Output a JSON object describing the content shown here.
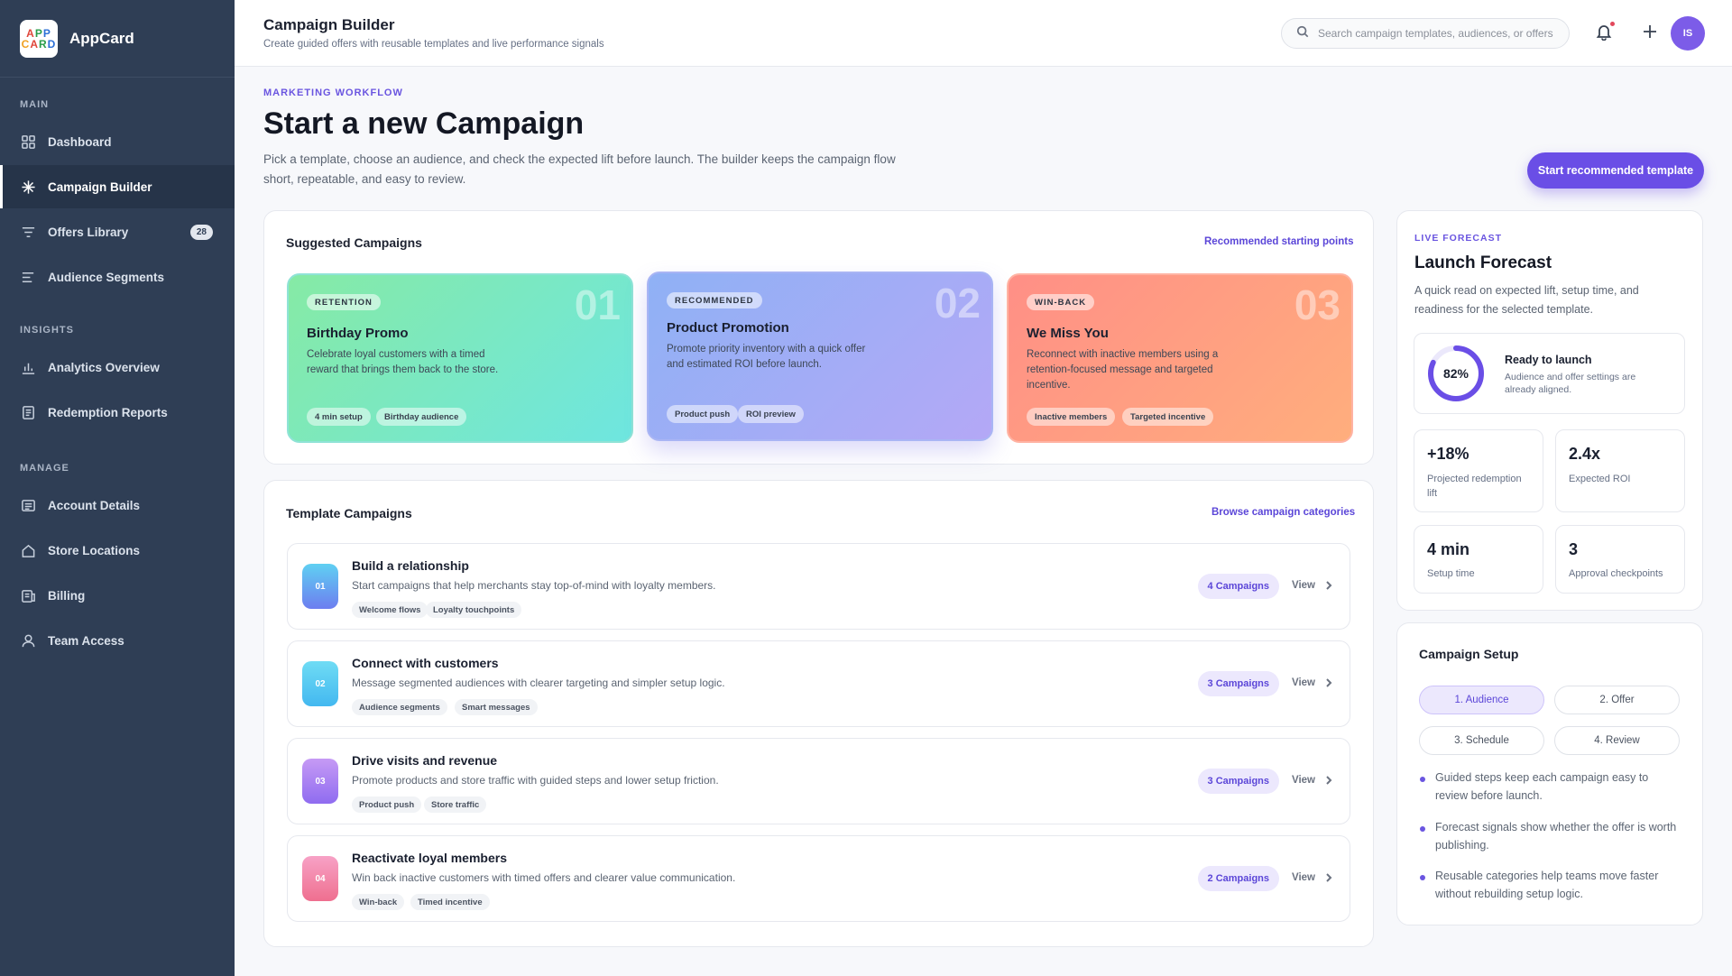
{
  "brand": {
    "logo_line1": [
      "A",
      "P",
      "P"
    ],
    "logo_line2": [
      "C",
      "A",
      "R",
      "D"
    ],
    "name": "AppCard"
  },
  "sidebar": {
    "sections": [
      "MAIN",
      "INSIGHTS",
      "MANAGE"
    ],
    "items": [
      {
        "label": "Dashboard",
        "icon": "grid-icon"
      },
      {
        "label": "Campaign Builder",
        "icon": "sparkle-icon",
        "active": true
      },
      {
        "label": "Offers Library",
        "icon": "filter-icon",
        "badge": "28"
      },
      {
        "label": "Audience Segments",
        "icon": "lines-icon"
      },
      {
        "label": "Analytics Overview",
        "icon": "bar-chart-icon"
      },
      {
        "label": "Redemption Reports",
        "icon": "report-icon"
      },
      {
        "label": "Account Details",
        "icon": "account-card-icon"
      },
      {
        "label": "Store Locations",
        "icon": "home-icon"
      },
      {
        "label": "Billing",
        "icon": "billing-icon"
      },
      {
        "label": "Team Access",
        "icon": "user-icon"
      }
    ]
  },
  "header": {
    "title": "Campaign Builder",
    "subtitle": "Create guided offers with reusable templates and live performance signals",
    "search_placeholder": "Search campaign templates, audiences, or offers",
    "avatar_initials": "IS"
  },
  "hero": {
    "eyebrow": "MARKETING WORKFLOW",
    "title": "Start a new Campaign",
    "description": "Pick a template, choose an audience, and check the expected lift before launch. The builder keeps the campaign flow short, repeatable, and easy to review.",
    "cta": "Start recommended template"
  },
  "suggested": {
    "title": "Suggested Campaigns",
    "link": "Recommended starting points",
    "cards": [
      {
        "num": "01",
        "tag": "RETENTION",
        "title": "Birthday Promo",
        "desc": "Celebrate loyal customers with a timed reward that brings them back to the store.",
        "chips": [
          "4 min setup",
          "Birthday audience"
        ]
      },
      {
        "num": "02",
        "tag": "RECOMMENDED",
        "title": "Product Promotion",
        "desc": "Promote priority inventory with a quick offer and estimated ROI before launch.",
        "chips": [
          "Product push",
          "ROI preview"
        ]
      },
      {
        "num": "03",
        "tag": "WIN-BACK",
        "title": "We Miss You",
        "desc": "Reconnect with inactive members using a retention-focused message and targeted incentive.",
        "chips": [
          "Inactive members",
          "Targeted incentive"
        ]
      }
    ]
  },
  "templates": {
    "title": "Template Campaigns",
    "link": "Browse campaign categories",
    "view_label": "View",
    "rows": [
      {
        "num": "01",
        "title": "Build a relationship",
        "desc": "Start campaigns that help merchants stay top-of-mind with loyalty members.",
        "chips": [
          "Welcome flows",
          "Loyalty touchpoints"
        ],
        "count": "4 Campaigns"
      },
      {
        "num": "02",
        "title": "Connect with customers",
        "desc": "Message segmented audiences with clearer targeting and simpler setup logic.",
        "chips": [
          "Audience segments",
          "Smart messages"
        ],
        "count": "3 Campaigns"
      },
      {
        "num": "03",
        "title": "Drive visits and revenue",
        "desc": "Promote products and store traffic with guided steps and lower setup friction.",
        "chips": [
          "Product push",
          "Store traffic"
        ],
        "count": "3 Campaigns"
      },
      {
        "num": "04",
        "title": "Reactivate loyal members",
        "desc": "Win back inactive customers with timed offers and clearer value communication.",
        "chips": [
          "Win-back",
          "Timed incentive"
        ],
        "count": "2 Campaigns"
      }
    ]
  },
  "forecast": {
    "eyebrow": "LIVE FORECAST",
    "title": "Launch Forecast",
    "description": "A quick read on expected lift, setup time, and readiness for the selected template.",
    "readiness_value": 0.82,
    "readiness_label": "82%",
    "readiness_title": "Ready to launch",
    "readiness_desc": "Audience and offer settings are already aligned.",
    "metrics": [
      {
        "value": "+18%",
        "label": "Projected redemption lift"
      },
      {
        "value": "2.4x",
        "label": "Expected ROI"
      },
      {
        "value": "4 min",
        "label": "Setup time"
      },
      {
        "value": "3",
        "label": "Approval checkpoints"
      }
    ]
  },
  "setup": {
    "title": "Campaign Setup",
    "steps": [
      "1. Audience",
      "2. Offer",
      "3. Schedule",
      "4. Review"
    ],
    "notes": [
      "Guided steps keep each campaign easy to review before launch.",
      "Forecast signals show whether the offer is worth publishing.",
      "Reusable categories help teams move faster without rebuilding setup logic."
    ]
  },
  "colors": {
    "accent": "#6a4ee6",
    "sidebar": "#2f3e55"
  }
}
